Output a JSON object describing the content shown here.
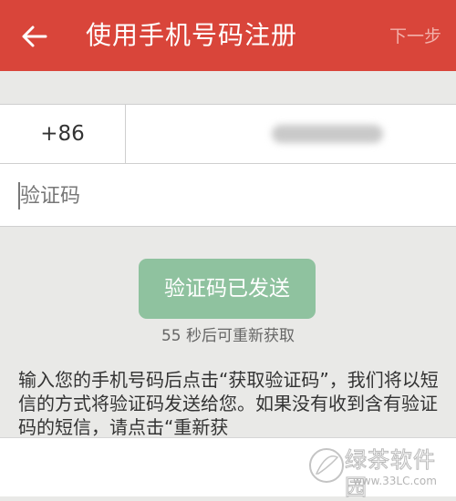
{
  "header": {
    "title": "使用手机号码注册",
    "next_label": "下一步"
  },
  "form": {
    "country_code": "+86",
    "verification_placeholder": "验证码"
  },
  "verify": {
    "sent_button_label": "验证码已发送",
    "countdown_text": "55 秒后可重新获取"
  },
  "description": "输入您的手机号码后点击“获取验证码”，我们将以短信的方式将验证码发送给您。如果没有收到含有验证码的短信，请点击“重新获",
  "watermark": {
    "cn": "绿茶软件园",
    "url": "www.33LC.com"
  },
  "colors": {
    "header_bg": "#d9453a",
    "sent_button_bg": "#8fc29f",
    "page_bg": "#e9e9e7"
  }
}
